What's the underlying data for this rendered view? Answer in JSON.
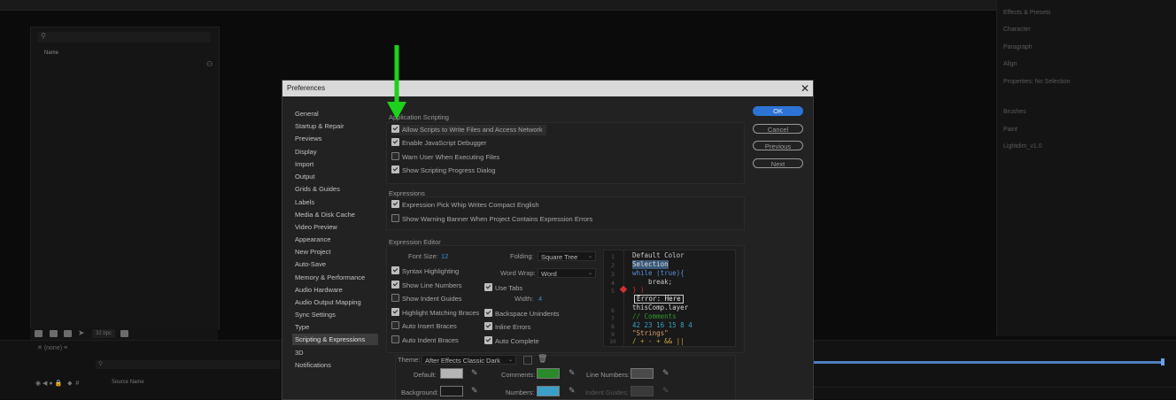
{
  "background": {
    "project_search_placeholder": "",
    "name_column": "Name",
    "bpc": "32 bpc",
    "timeline_tab": "(none)",
    "source_name": "Source Name",
    "right_panels": [
      "Effects & Presets",
      "Character",
      "Paragraph",
      "Align",
      "Properties: No Selection",
      "Brushes",
      "Paint",
      "Lightdim_v1.0"
    ]
  },
  "dialog": {
    "title": "Preferences",
    "close": "✕",
    "categories": [
      "General",
      "Startup & Repair",
      "Previews",
      "Display",
      "Import",
      "Output",
      "Grids & Guides",
      "Labels",
      "Media & Disk Cache",
      "Video Preview",
      "Appearance",
      "New Project",
      "Auto-Save",
      "Memory & Performance",
      "Audio Hardware",
      "Audio Output Mapping",
      "Sync Settings",
      "Type",
      "Scripting & Expressions",
      "3D",
      "Notifications"
    ],
    "selected_category": "Scripting & Expressions",
    "buttons": {
      "ok": "OK",
      "cancel": "Cancel",
      "previous": "Previous",
      "next": "Next"
    },
    "app_scripting": {
      "title": "Application Scripting",
      "items": [
        {
          "label": "Allow Scripts to Write Files and Access Network",
          "checked": true
        },
        {
          "label": "Enable JavaScript Debugger",
          "checked": true
        },
        {
          "label": "Warn User When Executing Files",
          "checked": false
        },
        {
          "label": "Show Scripting Progress Dialog",
          "checked": true
        }
      ]
    },
    "expressions": {
      "title": "Expressions",
      "items": [
        {
          "label": "Expression Pick Whip Writes Compact English",
          "checked": true
        },
        {
          "label": "Show Warning Banner When Project Contains Expression Errors",
          "checked": false
        }
      ]
    },
    "editor": {
      "title": "Expression Editor",
      "font_size_label": "Font Size:",
      "font_size_value": "12",
      "folding_label": "Folding:",
      "folding_value": "Square Tree",
      "word_wrap_label": "Word Wrap:",
      "word_wrap_value": "Word",
      "use_tabs": {
        "label": "Use Tabs",
        "checked": true
      },
      "width_label": "Width:",
      "width_value": "4",
      "left_checks": [
        {
          "label": "Syntax Highlighting",
          "checked": true
        },
        {
          "label": "Show Line Numbers",
          "checked": true
        },
        {
          "label": "Show Indent Guides",
          "checked": false
        },
        {
          "label": "Highlight Matching Braces",
          "checked": true
        },
        {
          "label": "Auto Insert Braces",
          "checked": false
        },
        {
          "label": "Auto Indent Braces",
          "checked": false
        }
      ],
      "right_checks": [
        {
          "label": "Backspace Unindents",
          "checked": true
        },
        {
          "label": "Inline Errors",
          "checked": true
        },
        {
          "label": "Auto Complete",
          "checked": true
        }
      ],
      "preview_lines": [
        "1",
        "2",
        "3",
        "4",
        "5",
        "",
        "6",
        "7",
        "8",
        "9",
        "10"
      ],
      "preview_code": {
        "l1": "Default Color",
        "l2": "Selection",
        "l3": "while (true){",
        "l4": "    break;",
        "l5": "} )",
        "l5b": "Error: Here",
        "l6": "thisComp.layer",
        "l7": "// Comments",
        "l8": "42 23 16 15 8 4",
        "l9": "\"Strings\"",
        "l10": "/ + - + && ||"
      }
    },
    "theme": {
      "label": "Theme:",
      "value": "After Effects Classic Dark",
      "default_label": "Default:",
      "comments_label": "Comments:",
      "line_numbers_label": "Line Numbers:",
      "background_label": "Background:",
      "numbers_label": "Numbers:",
      "indent_guides_label": "Indent Guides:",
      "colors": {
        "default": "#b5b5b5",
        "comments": "#2a8a2a",
        "line_numbers": "#4a4a4a",
        "background": "#1a1a1a",
        "numbers": "#3aa0c8",
        "indent_guides": "#3a3a3a"
      }
    }
  },
  "annotation_arrow_color": "#1dd11d"
}
